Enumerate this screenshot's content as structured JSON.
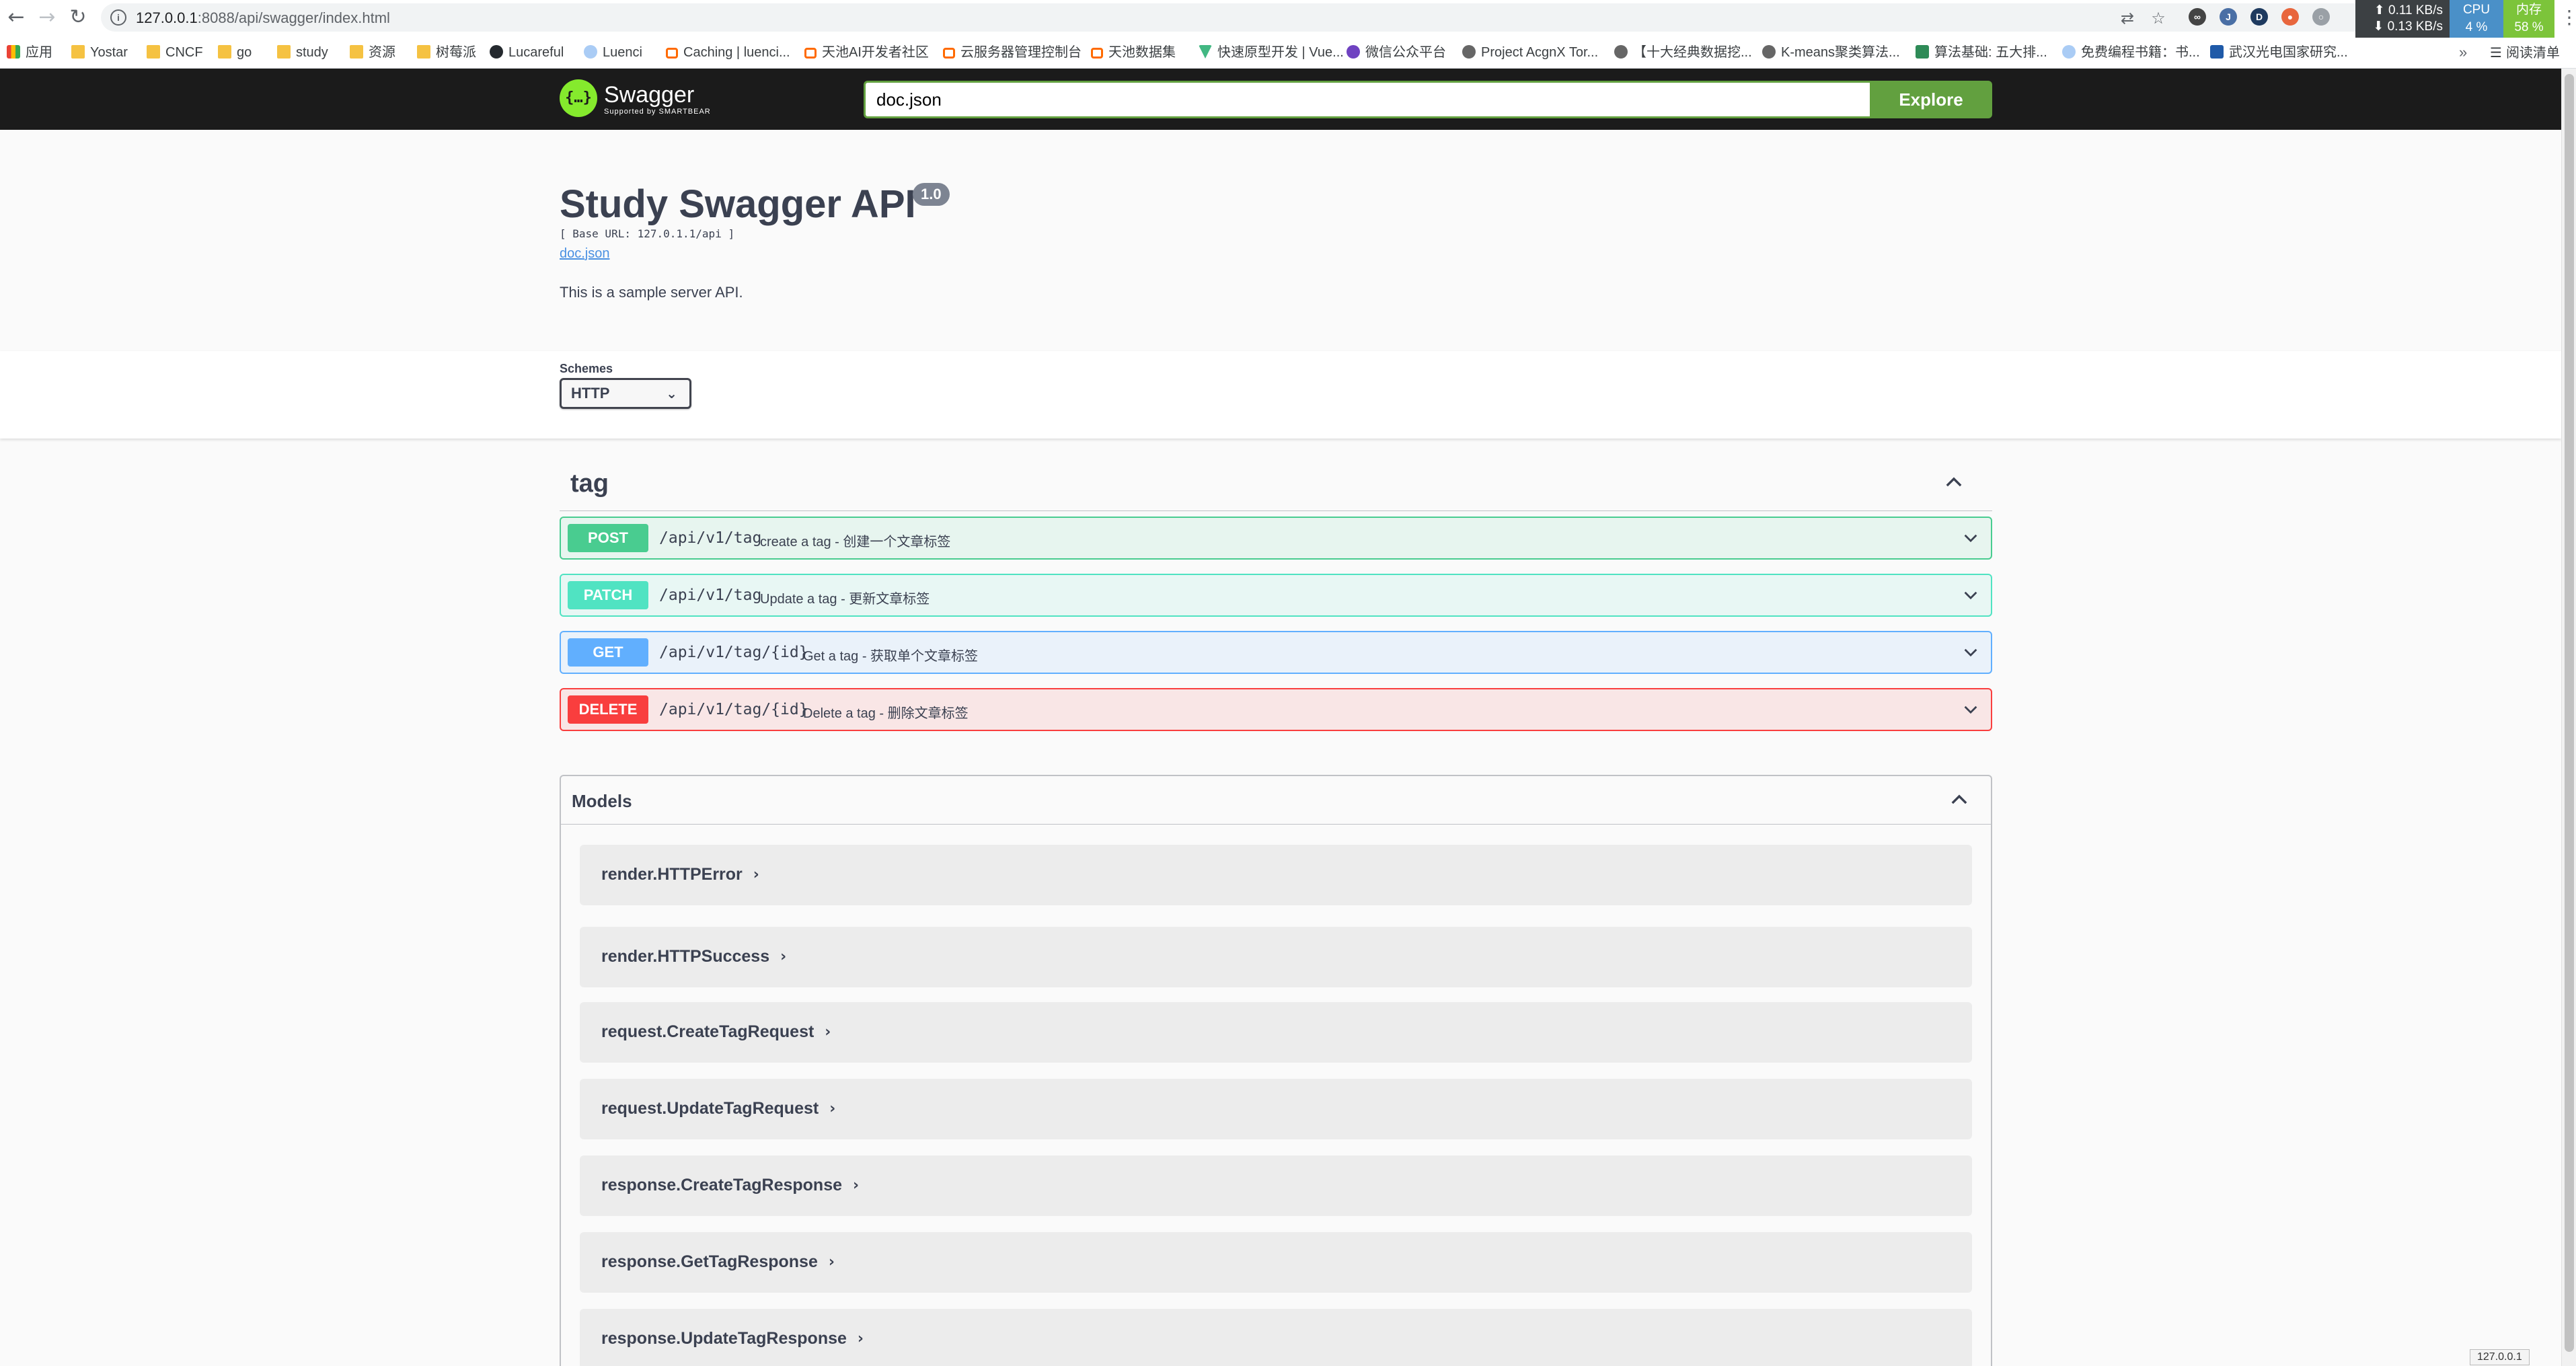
{
  "browser": {
    "url_host": "127.0.0.1",
    "url_rest": ":8088/api/swagger/index.html",
    "net_up": "0.11 KB/s",
    "net_down": "0.13 KB/s",
    "cpu_label": "CPU",
    "cpu_value": "4 %",
    "mem_label": "内存",
    "mem_value": "58 %",
    "bookmarks": [
      {
        "label": "应用",
        "icon": "apps-icon"
      },
      {
        "label": "Yostar",
        "icon": "folder-icon"
      },
      {
        "label": "CNCF",
        "icon": "folder-icon"
      },
      {
        "label": "go",
        "icon": "folder-icon"
      },
      {
        "label": "study",
        "icon": "folder-icon"
      },
      {
        "label": "资源",
        "icon": "folder-icon"
      },
      {
        "label": "树莓派",
        "icon": "folder-icon"
      },
      {
        "label": "Lucareful",
        "icon": "github-icon"
      },
      {
        "label": "Luenci",
        "icon": "globe-icon"
      },
      {
        "label": "Caching | luenci...",
        "icon": "cloud-icon"
      },
      {
        "label": "天池AI开发者社区",
        "icon": "aliyun-icon"
      },
      {
        "label": "云服务器管理控制台",
        "icon": "aliyun-icon"
      },
      {
        "label": "天池数据集",
        "icon": "aliyun-icon"
      },
      {
        "label": "快速原型开发 | Vue...",
        "icon": "vue-icon"
      },
      {
        "label": "微信公众平台",
        "icon": "link-icon"
      },
      {
        "label": "Project AcgnX Tor...",
        "icon": "gear-icon"
      },
      {
        "label": "【十大经典数据挖...",
        "icon": "lambda-icon"
      },
      {
        "label": "K-means聚类算法...",
        "icon": "lambda-icon"
      },
      {
        "label": "算法基础: 五大排...",
        "icon": "book-icon"
      },
      {
        "label": "免费编程书籍：书...",
        "icon": "globe-icon"
      },
      {
        "label": "武汉光电国家研究...",
        "icon": "wnlo-icon"
      }
    ],
    "more_label": "»",
    "reading_list": "阅读清单",
    "status": "127.0.0.1"
  },
  "topbar": {
    "logo_title": "Swagger",
    "logo_sub": "Supported by SMARTBEAR",
    "url_value": "doc.json",
    "explore_label": "Explore"
  },
  "info": {
    "title": "Study Swagger API",
    "version": "1.0",
    "base_url": "[ Base URL: 127.0.1.1/api ]",
    "doc_link": "doc.json",
    "description": "This is a sample server API."
  },
  "schemes": {
    "label": "Schemes",
    "selected": "HTTP"
  },
  "tag": {
    "name": "tag",
    "operations": [
      {
        "method": "POST",
        "path": "/api/v1/tag",
        "summary": "create a tag - 创建一个文章标签"
      },
      {
        "method": "PATCH",
        "path": "/api/v1/tag",
        "summary": "Update a tag - 更新文章标签"
      },
      {
        "method": "GET",
        "path": "/api/v1/tag/{id}",
        "summary": "Get a tag - 获取单个文章标签"
      },
      {
        "method": "DELETE",
        "path": "/api/v1/tag/{id}",
        "summary": "Delete a tag - 删除文章标签"
      }
    ]
  },
  "models": {
    "title": "Models",
    "items": [
      "render.HTTPError",
      "render.HTTPSuccess",
      "request.CreateTagRequest",
      "request.UpdateTagRequest",
      "response.CreateTagResponse",
      "response.GetTagResponse",
      "response.UpdateTagResponse"
    ]
  },
  "colors": {
    "post": "#49cc90",
    "patch": "#50e3c2",
    "get": "#61affe",
    "delete": "#f93e3e",
    "explore": "#62a03f"
  }
}
